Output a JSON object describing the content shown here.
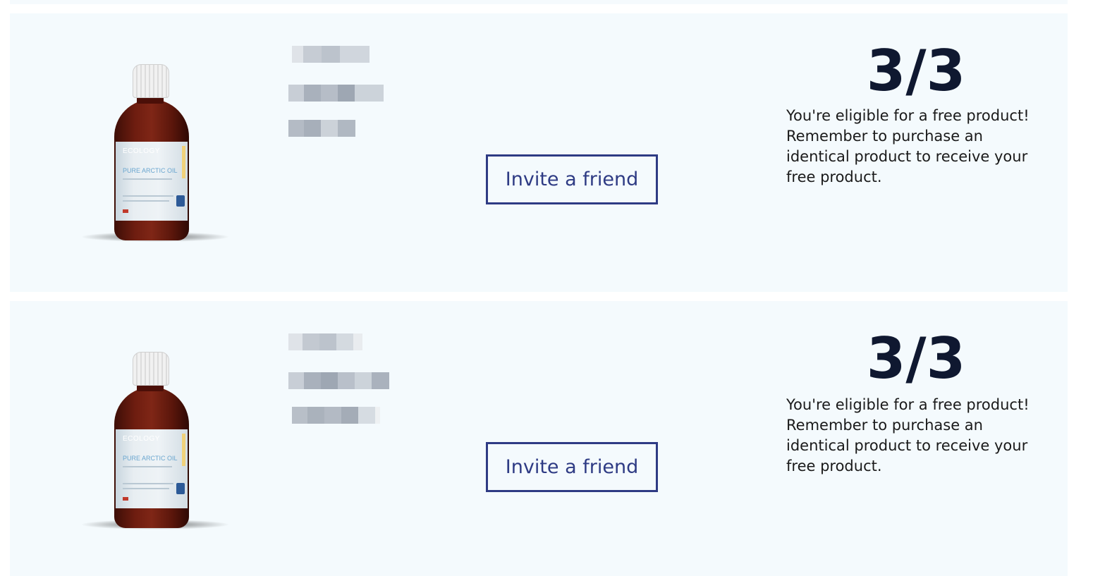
{
  "rewards": [
    {
      "product_image": {
        "brand": "ECOLOGY",
        "name": "PURE ARCTIC OIL"
      },
      "invite_label": "Invite a friend",
      "progress": "3/3",
      "message": "You're eligible for a free product! Remember to purchase an identical product to receive your free product."
    },
    {
      "product_image": {
        "brand": "ECOLOGY",
        "name": "PURE ARCTIC OIL"
      },
      "invite_label": "Invite a friend",
      "progress": "3/3",
      "message": "You're eligible for a free product! Remember to purchase an identical product to receive your free product."
    }
  ],
  "colors": {
    "card_bg": "#f4fafd",
    "button_accent": "#2e3b84",
    "counter_text": "#0f1830"
  }
}
